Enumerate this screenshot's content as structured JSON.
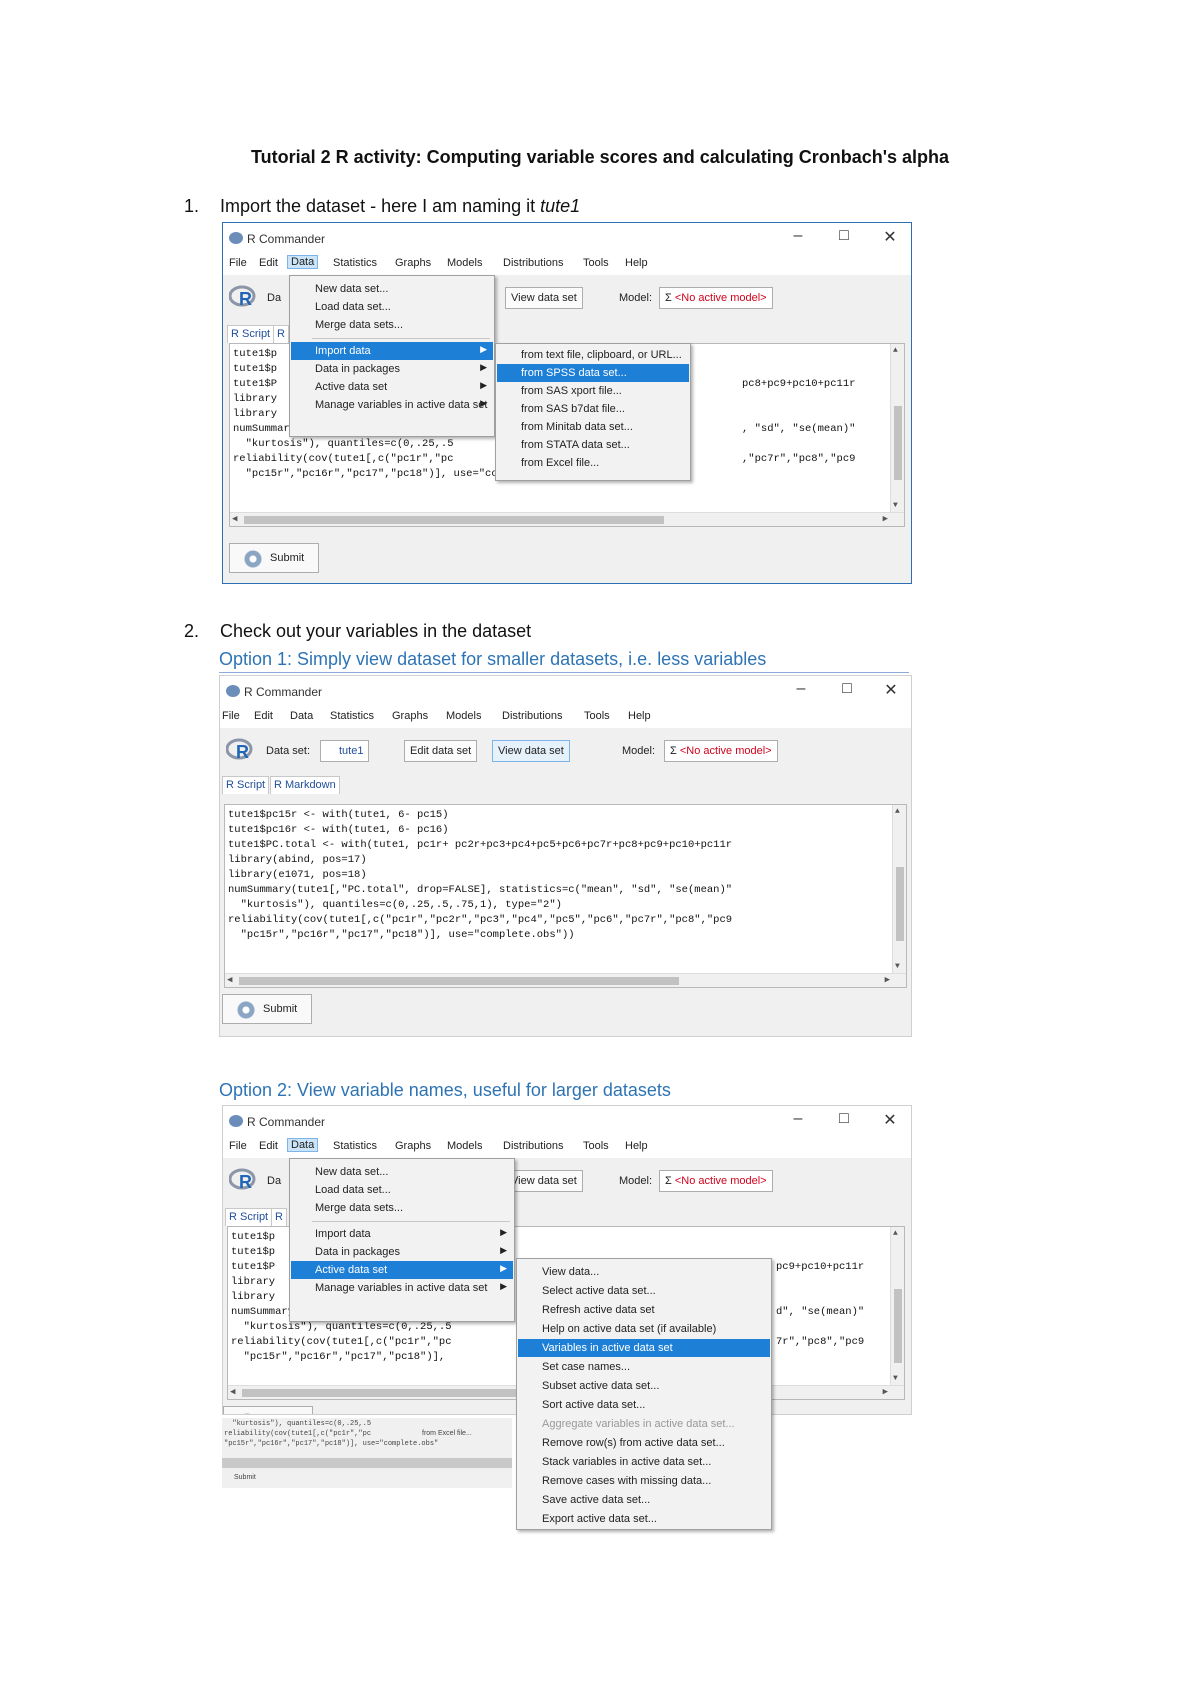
{
  "doc": {
    "title": "Tutorial 2 R activity: Computing variable scores and calculating Cronbach's alpha",
    "step1_num": "1.",
    "step1_text": "Import the dataset - here I am naming it ",
    "step1_italic": "tute1",
    "step2_num": "2.",
    "step2_text": "Check out your variables in the dataset",
    "option1": "Option 1: Simply view dataset for smaller datasets, i.e. less variables",
    "option2": "Option 2: View variable names, useful for larger datasets"
  },
  "rcmdr": {
    "title": "R Commander",
    "win_min": "–",
    "win_max": "□",
    "win_close": "✕",
    "menus": [
      "File",
      "Edit",
      "Data",
      "Statistics",
      "Graphs",
      "Models",
      "Distributions",
      "Tools",
      "Help"
    ],
    "dataset_label": "Data set:",
    "dataset_value": "tute1",
    "dataset_label_trunc": "Da",
    "edit_btn": "Edit data set",
    "view_btn": "View data set",
    "model_label": "Model:",
    "model_sigma": "Σ",
    "model_value": "<No active model>",
    "tab_script": "R Script",
    "tab_markdown": "R Markdown",
    "tab_trunc": "R",
    "submit": "Submit"
  },
  "window1": {
    "script_lines": [
      "tute1$p",
      "tute1$p",
      "tute1$P",
      "library",
      "library",
      "numSummary(tute1[,\"PC.total\", drop=",
      "  \"kurtosis\"), quantiles=c(0,.25,.5",
      "reliability(cov(tute1[,c(\"pc1r\",\"pc",
      "  \"pc15r\",\"pc16r\",\"pc17\",\"pc18\")], use=\"complete.obs\"))"
    ],
    "script_right": [
      "pc8+pc9+pc10+pc11r",
      ", \"sd\", \"se(mean)\"",
      ",\"pc7r\",\"pc8\",\"pc9"
    ],
    "data_menu": [
      "New data set...",
      "Load data set...",
      "Merge data sets...",
      "Import data",
      "Data in packages",
      "Active data set",
      "Manage variables in active data set"
    ],
    "import_menu": [
      "from text file, clipboard, or URL...",
      "from SPSS data set...",
      "from SAS xport file...",
      "from SAS b7dat file...",
      "from Minitab data set...",
      "from STATA data set...",
      "from Excel file..."
    ]
  },
  "window2": {
    "script_lines": [
      "tute1$pc15r <- with(tute1, 6- pc15)",
      "tute1$pc16r <- with(tute1, 6- pc16)",
      "tute1$PC.total <- with(tute1, pc1r+ pc2r+pc3+pc4+pc5+pc6+pc7r+pc8+pc9+pc10+pc11r",
      "library(abind, pos=17)",
      "library(e1071, pos=18)",
      "numSummary(tute1[,\"PC.total\", drop=FALSE], statistics=c(\"mean\", \"sd\", \"se(mean)\"",
      "  \"kurtosis\"), quantiles=c(0,.25,.5,.75,1), type=\"2\")",
      "reliability(cov(tute1[,c(\"pc1r\",\"pc2r\",\"pc3\",\"pc4\",\"pc5\",\"pc6\",\"pc7r\",\"pc8\",\"pc9",
      "  \"pc15r\",\"pc16r\",\"pc17\",\"pc18\")], use=\"complete.obs\"))"
    ]
  },
  "window3": {
    "script_lines": [
      "tute1$p",
      "tute1$p",
      "tute1$P",
      "library",
      "library",
      "numSummary(tute1[,\"PC.total\", drop=",
      "  \"kurtosis\"), quantiles=c(0,.25,.5",
      "reliability(cov(tute1[,c(\"pc1r\",\"pc",
      "  \"pc15r\",\"pc16r\",\"pc17\",\"pc18\")],"
    ],
    "script_right": [
      "pc9+pc10+pc11r",
      "d\", \"se(mean)\"",
      "7r\",\"pc8\",\"pc9"
    ],
    "data_menu": [
      "New data set...",
      "Load data set...",
      "Merge data sets...",
      "Import data",
      "Data in packages",
      "Active data set",
      "Manage variables in active data set"
    ],
    "active_menu": [
      "View data...",
      "Select active data set...",
      "Refresh active data set",
      "Help on active data set (if available)",
      "Variables in active data set",
      "Set case names...",
      "Subset active data set...",
      "Sort active data set...",
      "Aggregate variables in active data set...",
      "Remove row(s) from active data set...",
      "Stack variables in active data set...",
      "Remove cases with missing data...",
      "Save active data set...",
      "Export active data set..."
    ],
    "ghost_lines": [
      "  \"kurtosis\"), quantiles=c(0,.25,.5",
      "reliability(cov(tute1[,c(\"pc1r\",\"pc",
      "\"pc15r\",\"pc16r\",\"pc17\",\"pc18\")], use=\"complete.obs\""
    ],
    "ghost_excel": "from Excel file...",
    "ghost_submit": "Submit"
  }
}
